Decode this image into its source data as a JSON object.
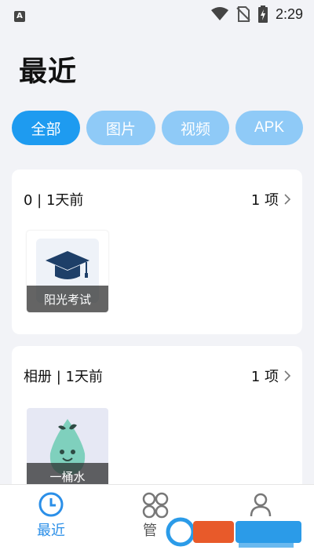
{
  "status_bar": {
    "left_icon": "a-notification-icon",
    "time": "2:29",
    "icons": [
      "wifi-icon",
      "no-sim-icon",
      "battery-charging-icon"
    ]
  },
  "page": {
    "title": "最近"
  },
  "filters": [
    {
      "label": "全部",
      "active": true
    },
    {
      "label": "图片",
      "active": false
    },
    {
      "label": "视频",
      "active": false
    },
    {
      "label": "APK",
      "active": false
    }
  ],
  "groups": [
    {
      "title": "0 | 1天前",
      "count": "1 项",
      "item": {
        "label": "阳光考试",
        "icon": "graduation-cap-icon"
      }
    },
    {
      "title": "相册 | 1天前",
      "count": "1 项",
      "item": {
        "label": "一桶水",
        "icon": "water-drop-icon"
      }
    }
  ],
  "bottom_nav": [
    {
      "label": "最近",
      "icon": "clock-icon",
      "active": true
    },
    {
      "label": "管",
      "icon": "four-petal-grid-icon",
      "active": false
    },
    {
      "label": "",
      "icon": "person-icon",
      "active": false
    }
  ],
  "colors": {
    "accent": "#1e9bf0",
    "chip_inactive": "#8fcaf7",
    "nav_active": "#2b8fe8"
  }
}
